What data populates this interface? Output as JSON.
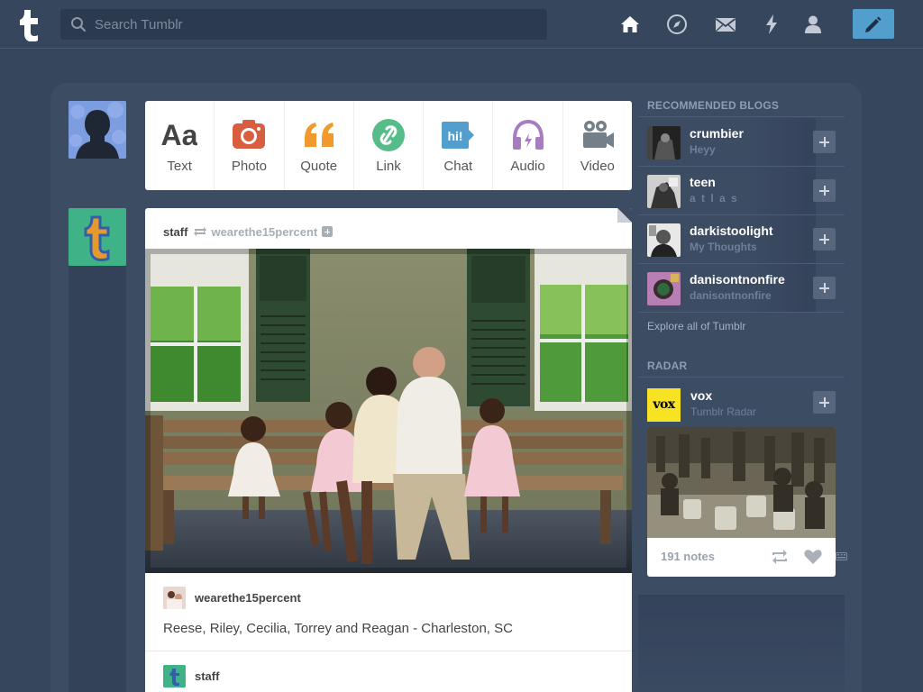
{
  "search": {
    "placeholder": "Search Tumblr"
  },
  "nav": {
    "icons": [
      "home-icon",
      "compass-icon",
      "mail-icon",
      "lightning-icon",
      "person-icon",
      "pencil-icon"
    ]
  },
  "post_types": [
    {
      "label": "Text",
      "icon": "text-icon",
      "color": "#444444",
      "glyph": "Aa"
    },
    {
      "label": "Photo",
      "icon": "camera-icon",
      "color": "#d95e40"
    },
    {
      "label": "Quote",
      "icon": "quote-icon",
      "color": "#f2992e",
      "glyph": "“"
    },
    {
      "label": "Link",
      "icon": "link-icon",
      "color": "#56bc8a"
    },
    {
      "label": "Chat",
      "icon": "chat-icon",
      "color": "#529ecc",
      "glyph": "hi!"
    },
    {
      "label": "Audio",
      "icon": "headphones-icon",
      "color": "#a77dc2"
    },
    {
      "label": "Video",
      "icon": "video-camera-icon",
      "color": "#748089"
    }
  ],
  "post": {
    "author": "staff",
    "reblogged_from": "wearethe15percent",
    "reblog_chain": [
      {
        "name": "wearethe15percent",
        "caption": "Reese, Riley, Cecilia, Torrey and Reagan - Charleston, SC"
      },
      {
        "name": "staff"
      }
    ]
  },
  "sidebar": {
    "recommended_title": "RECOMMENDED BLOGS",
    "blogs": [
      {
        "name": "crumbier",
        "desc": "Heyy"
      },
      {
        "name": "teen",
        "desc": "a t l a s"
      },
      {
        "name": "darkistoolight",
        "desc": "My Thoughts"
      },
      {
        "name": "danisontnonfire",
        "desc": "danisontnonfire"
      }
    ],
    "explore_label": "Explore all of Tumblr",
    "radar_title": "RADAR",
    "radar": {
      "avatar_text": "vox",
      "name": "vox",
      "desc": "Tumblr Radar",
      "notes": "191 notes"
    }
  },
  "colors": {
    "background": "#36465d",
    "panel": "#3c4c63",
    "accent": "#529ecc"
  }
}
